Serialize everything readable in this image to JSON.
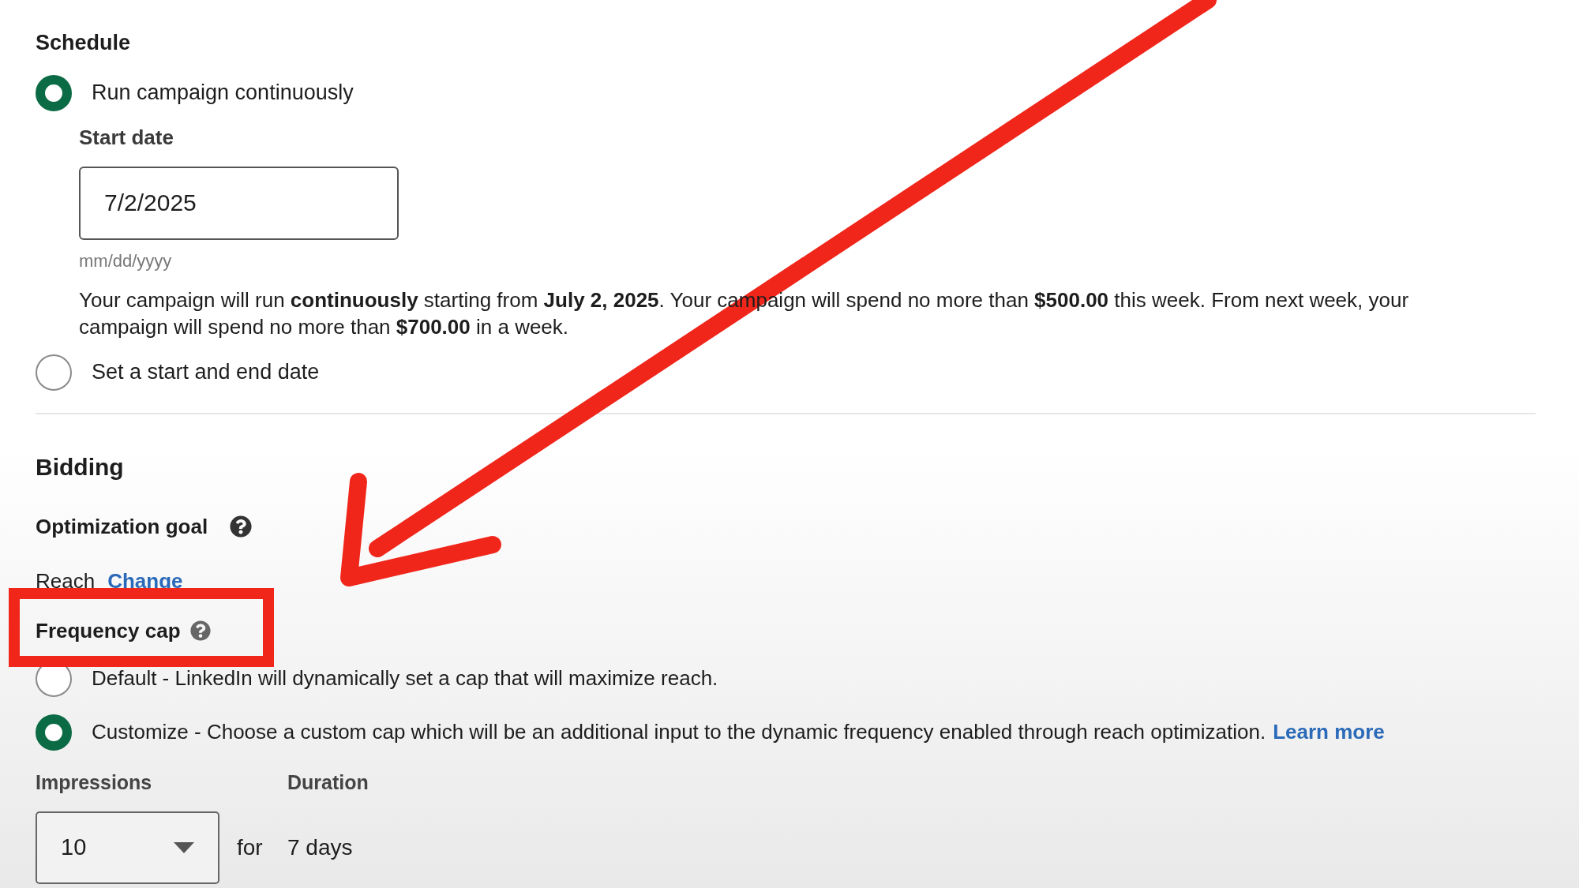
{
  "schedule": {
    "heading": "Schedule",
    "options": [
      {
        "label": "Run campaign continuously",
        "selected": true
      },
      {
        "label": "Set a start and end date",
        "selected": false
      }
    ],
    "start_date": {
      "label": "Start date",
      "value": "7/2/2025",
      "hint": "mm/dd/yyyy"
    },
    "summary": "Your campaign will run **continuously** starting from **July 2, 2025**. Your campaign will spend no more than **$500.00** this week. From next week, your campaign will spend no more than **$700.00** in a week."
  },
  "bidding": {
    "heading": "Bidding",
    "optimization_goal": {
      "label": "Optimization goal",
      "value": "Reach",
      "link": "Change"
    },
    "frequency_cap": {
      "label": "Frequency cap",
      "options": [
        {
          "label": "Default - LinkedIn will dynamically set a cap that will maximize reach.",
          "selected": false
        },
        {
          "label": "Customize - Choose a custom cap which will be an additional input to the dynamic frequency enabled through reach optimization.",
          "selected": true,
          "link": "Learn more"
        }
      ],
      "impressions": {
        "label": "Impressions",
        "value": "10"
      },
      "connector": "for",
      "duration": {
        "label": "Duration",
        "value": "7 days"
      }
    }
  }
}
